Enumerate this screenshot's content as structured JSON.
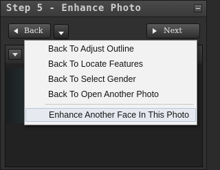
{
  "window": {
    "title": "Step 5 - Enhance Photo"
  },
  "nav": {
    "back_label": "Back",
    "next_label": "Next"
  },
  "menu": {
    "items": [
      {
        "label": "Back To Adjust Outline"
      },
      {
        "label": "Back To Locate Features"
      },
      {
        "label": "Back To Select Gender"
      },
      {
        "label": "Back To Open Another Photo"
      }
    ],
    "highlighted_item": {
      "label": "Enhance Another Face In This Photo"
    }
  },
  "colors": {
    "panel_background": "#303030",
    "menu_background": "#f2f2f2",
    "menu_highlight": "#e6eaf0",
    "title_text": "#cfcfcf"
  }
}
